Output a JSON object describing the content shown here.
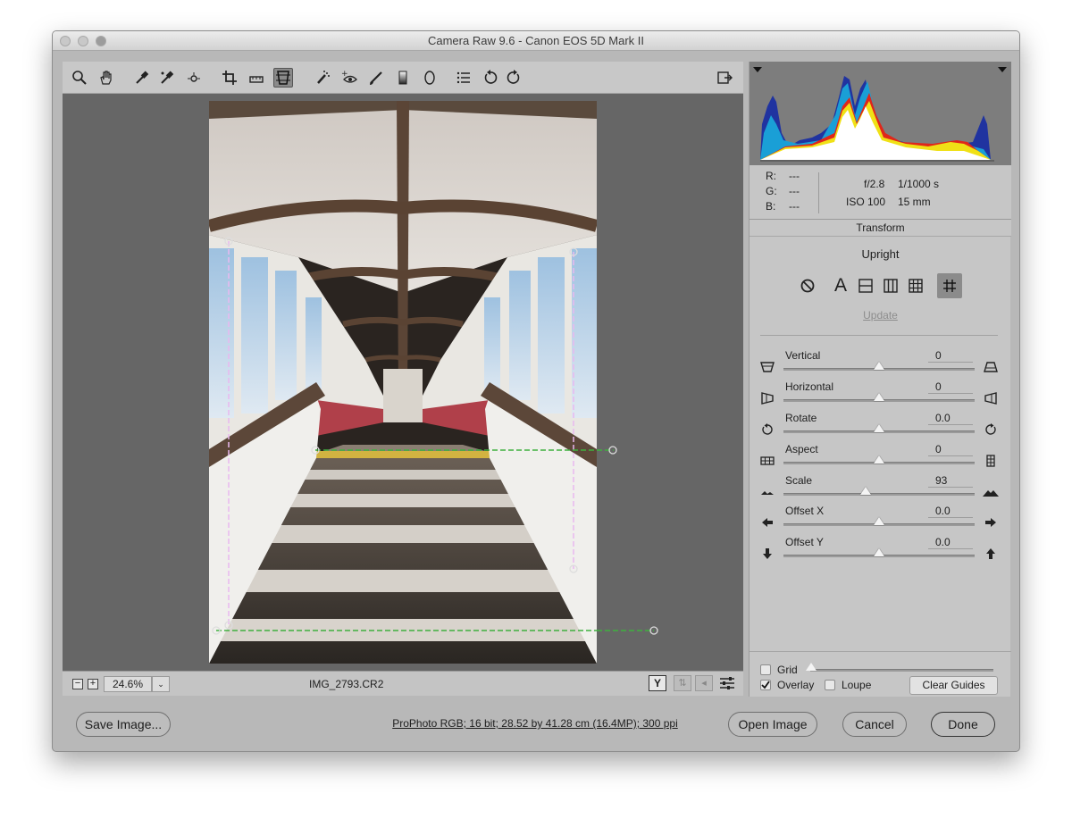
{
  "window": {
    "title": "Camera Raw 9.6  -  Canon EOS 5D Mark II"
  },
  "toolbar": {
    "tools": [
      "zoom-icon",
      "hand-icon",
      "white-balance-icon",
      "color-sampler-icon",
      "targeted-adjustment-icon",
      "crop-icon",
      "straighten-icon",
      "transform-icon",
      "spot-removal-icon",
      "red-eye-icon",
      "adjustment-brush-icon",
      "graduated-filter-icon",
      "radial-filter-icon",
      "preferences-icon",
      "rotate-ccw-icon",
      "rotate-cw-icon"
    ],
    "active_tool": "transform-icon"
  },
  "status": {
    "zoom": "24.6%",
    "filename": "IMG_2793.CR2"
  },
  "readout": {
    "r_label": "R:",
    "r_value": "---",
    "g_label": "G:",
    "g_value": "---",
    "b_label": "B:",
    "b_value": "---",
    "aperture": "f/2.8",
    "shutter": "1/1000 s",
    "iso": "ISO 100",
    "focal": "15 mm"
  },
  "panel": {
    "title": "Transform",
    "upright_label": "Upright",
    "update_label": "Update",
    "upright_buttons": [
      "off-icon",
      "auto-icon",
      "level-icon",
      "vertical-icon",
      "full-icon",
      "guided-icon"
    ],
    "active_upright": "guided-icon"
  },
  "sliders": [
    {
      "label": "Vertical",
      "value": "0",
      "position": 0.5
    },
    {
      "label": "Horizontal",
      "value": "0",
      "position": 0.5
    },
    {
      "label": "Rotate",
      "value": "0.0",
      "position": 0.5
    },
    {
      "label": "Aspect",
      "value": "0",
      "position": 0.5
    },
    {
      "label": "Scale",
      "value": "93",
      "position": 0.43
    },
    {
      "label": "Offset X",
      "value": "0.0",
      "position": 0.5
    },
    {
      "label": "Offset Y",
      "value": "0.0",
      "position": 0.5
    }
  ],
  "grid": {
    "label": "Grid",
    "checked": false
  },
  "overlay": {
    "overlay_label": "Overlay",
    "overlay_checked": true,
    "loupe_label": "Loupe",
    "loupe_checked": false,
    "clear_guides": "Clear Guides"
  },
  "footer": {
    "save_image": "Save Image...",
    "workflow_info": "ProPhoto RGB; 16 bit; 28.52 by 41.28 cm (16.4MP); 300 ppi",
    "open_image": "Open Image",
    "cancel": "Cancel",
    "done": "Done"
  }
}
